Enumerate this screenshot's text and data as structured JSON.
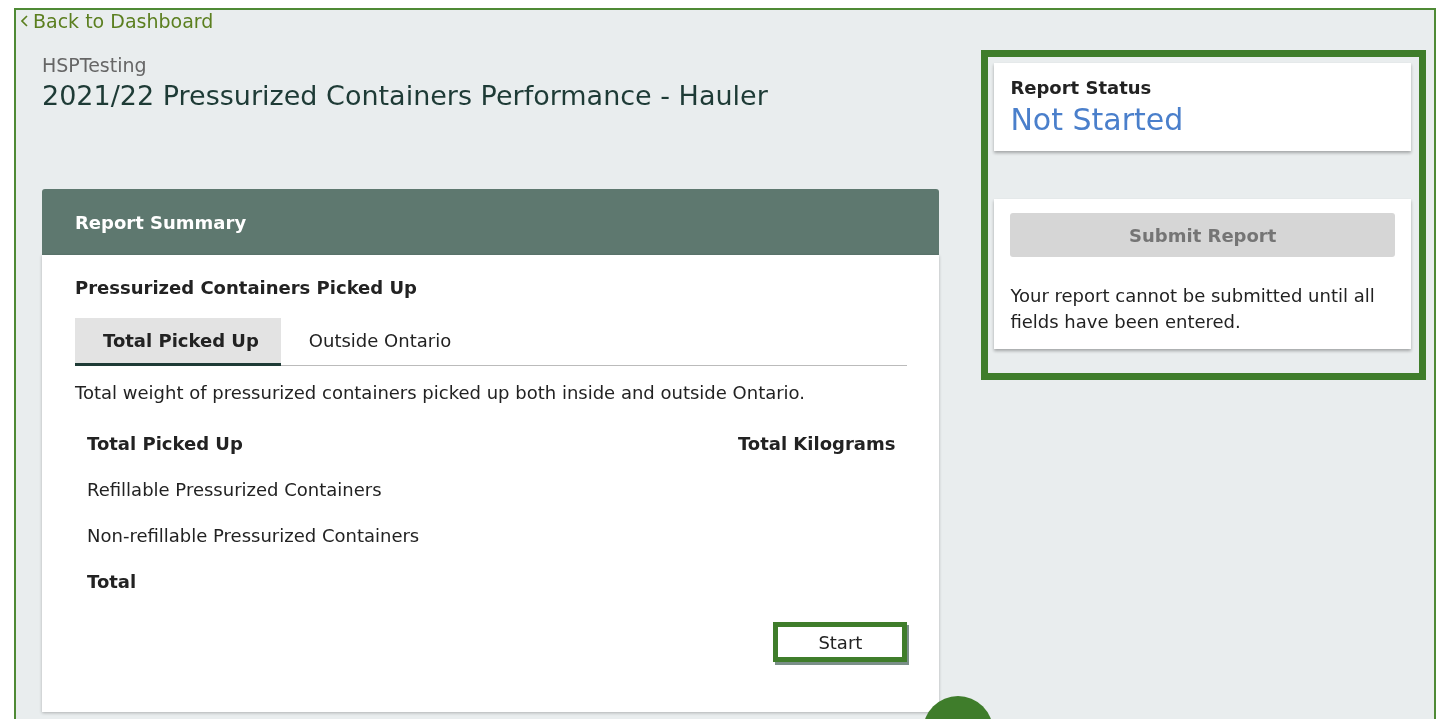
{
  "back_link": {
    "label": "Back to Dashboard"
  },
  "header": {
    "organization": "HSPTesting",
    "title": "2021/22 Pressurized Containers Performance - Hauler"
  },
  "summary": {
    "heading": "Report Summary",
    "section_title": "Pressurized Containers Picked Up",
    "tabs": [
      {
        "label": "Total Picked Up",
        "selected": true
      },
      {
        "label": "Outside Ontario",
        "selected": false
      }
    ],
    "description": "Total weight of pressurized containers picked up both inside and outside Ontario.",
    "rows": [
      {
        "kind": "header",
        "label": "Total Picked Up",
        "value": "Total Kilograms"
      },
      {
        "kind": "item",
        "label": "Refillable Pressurized Containers"
      },
      {
        "kind": "item",
        "label": "Non-refillable Pressurized Containers"
      },
      {
        "kind": "total",
        "label": "Total"
      }
    ],
    "start_button": {
      "label": "Start",
      "highlighted": true
    }
  },
  "status_panel": {
    "highlighted": true,
    "label": "Report Status",
    "status": "Not Started",
    "submit_button": {
      "label": "Submit Report",
      "disabled": true
    },
    "note": "Your report cannot be submitted until all fields have been entered."
  },
  "callout": {
    "kind": "step-badge"
  }
}
